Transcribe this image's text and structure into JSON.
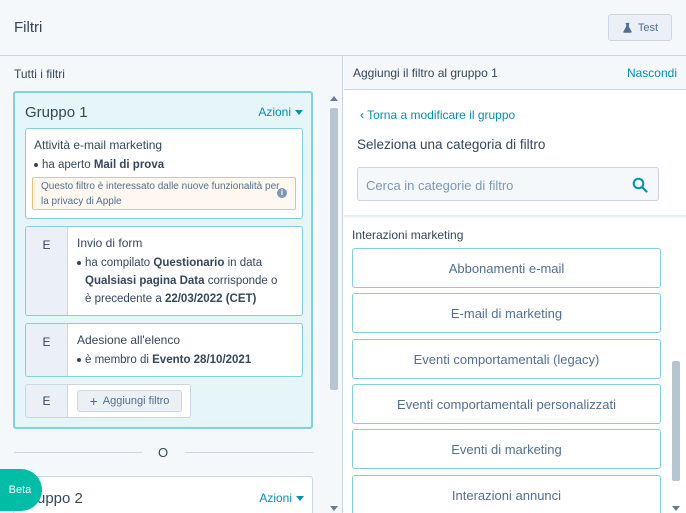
{
  "header": {
    "title": "Filtri",
    "test_label": "Test"
  },
  "left": {
    "title": "Tutti i filtri",
    "group1": {
      "title": "Gruppo 1",
      "actions": "Azioni",
      "filter1": {
        "title": "Attività e-mail marketing",
        "text": "ha aperto",
        "bold": "Mail di prova",
        "notice": "Questo filtro è interessato dalle nuove funzionalità per la privacy di Apple"
      },
      "filter2": {
        "prefix": "E",
        "title": "Invio di form",
        "t1": "ha compilato",
        "b1": "Questionario",
        "t2": "in data",
        "b2": "Qualsiasi pagina Data",
        "t3": "corrisponde o",
        "t4": "è precedente a",
        "b3": "22/03/2022 (CET)"
      },
      "filter3": {
        "prefix": "E",
        "title": "Adesione all'elenco",
        "t1": "è membro di",
        "b1": "Evento 28/10/2021"
      },
      "add": {
        "prefix": "E",
        "label": "Aggiungi filtro"
      }
    },
    "or_label": "O",
    "group2": {
      "title": "Gruppo 2",
      "title_visible": "uppo 2",
      "actions": "Azioni"
    },
    "beta_label": "Beta"
  },
  "right": {
    "title": "Aggiungi il filtro al gruppo 1",
    "hide_label": "Nascondi",
    "back_label": "Torna a modificare il gruppo",
    "select_title": "Seleziona una categoria di filtro",
    "search": {
      "placeholder": "Cerca in categorie di filtro",
      "value": ""
    },
    "section_title": "Interazioni marketing",
    "categories": [
      "Abbonamenti e-mail",
      "E-mail di marketing",
      "Eventi comportamentali (legacy)",
      "Eventi comportamentali personalizzati",
      "Eventi di marketing",
      "Interazioni annunci"
    ]
  },
  "colors": {
    "accent": "#0091ae",
    "group_bg": "#e5f5f8",
    "group_border": "#7fd1de",
    "beta": "#00bda5",
    "notice_border": "#f5c26b"
  },
  "icons": {
    "test": "flask-icon",
    "info": "info-icon",
    "search": "search-icon",
    "back": "chevron-left-icon",
    "actions": "caret-down-icon",
    "add": "plus-icon"
  }
}
